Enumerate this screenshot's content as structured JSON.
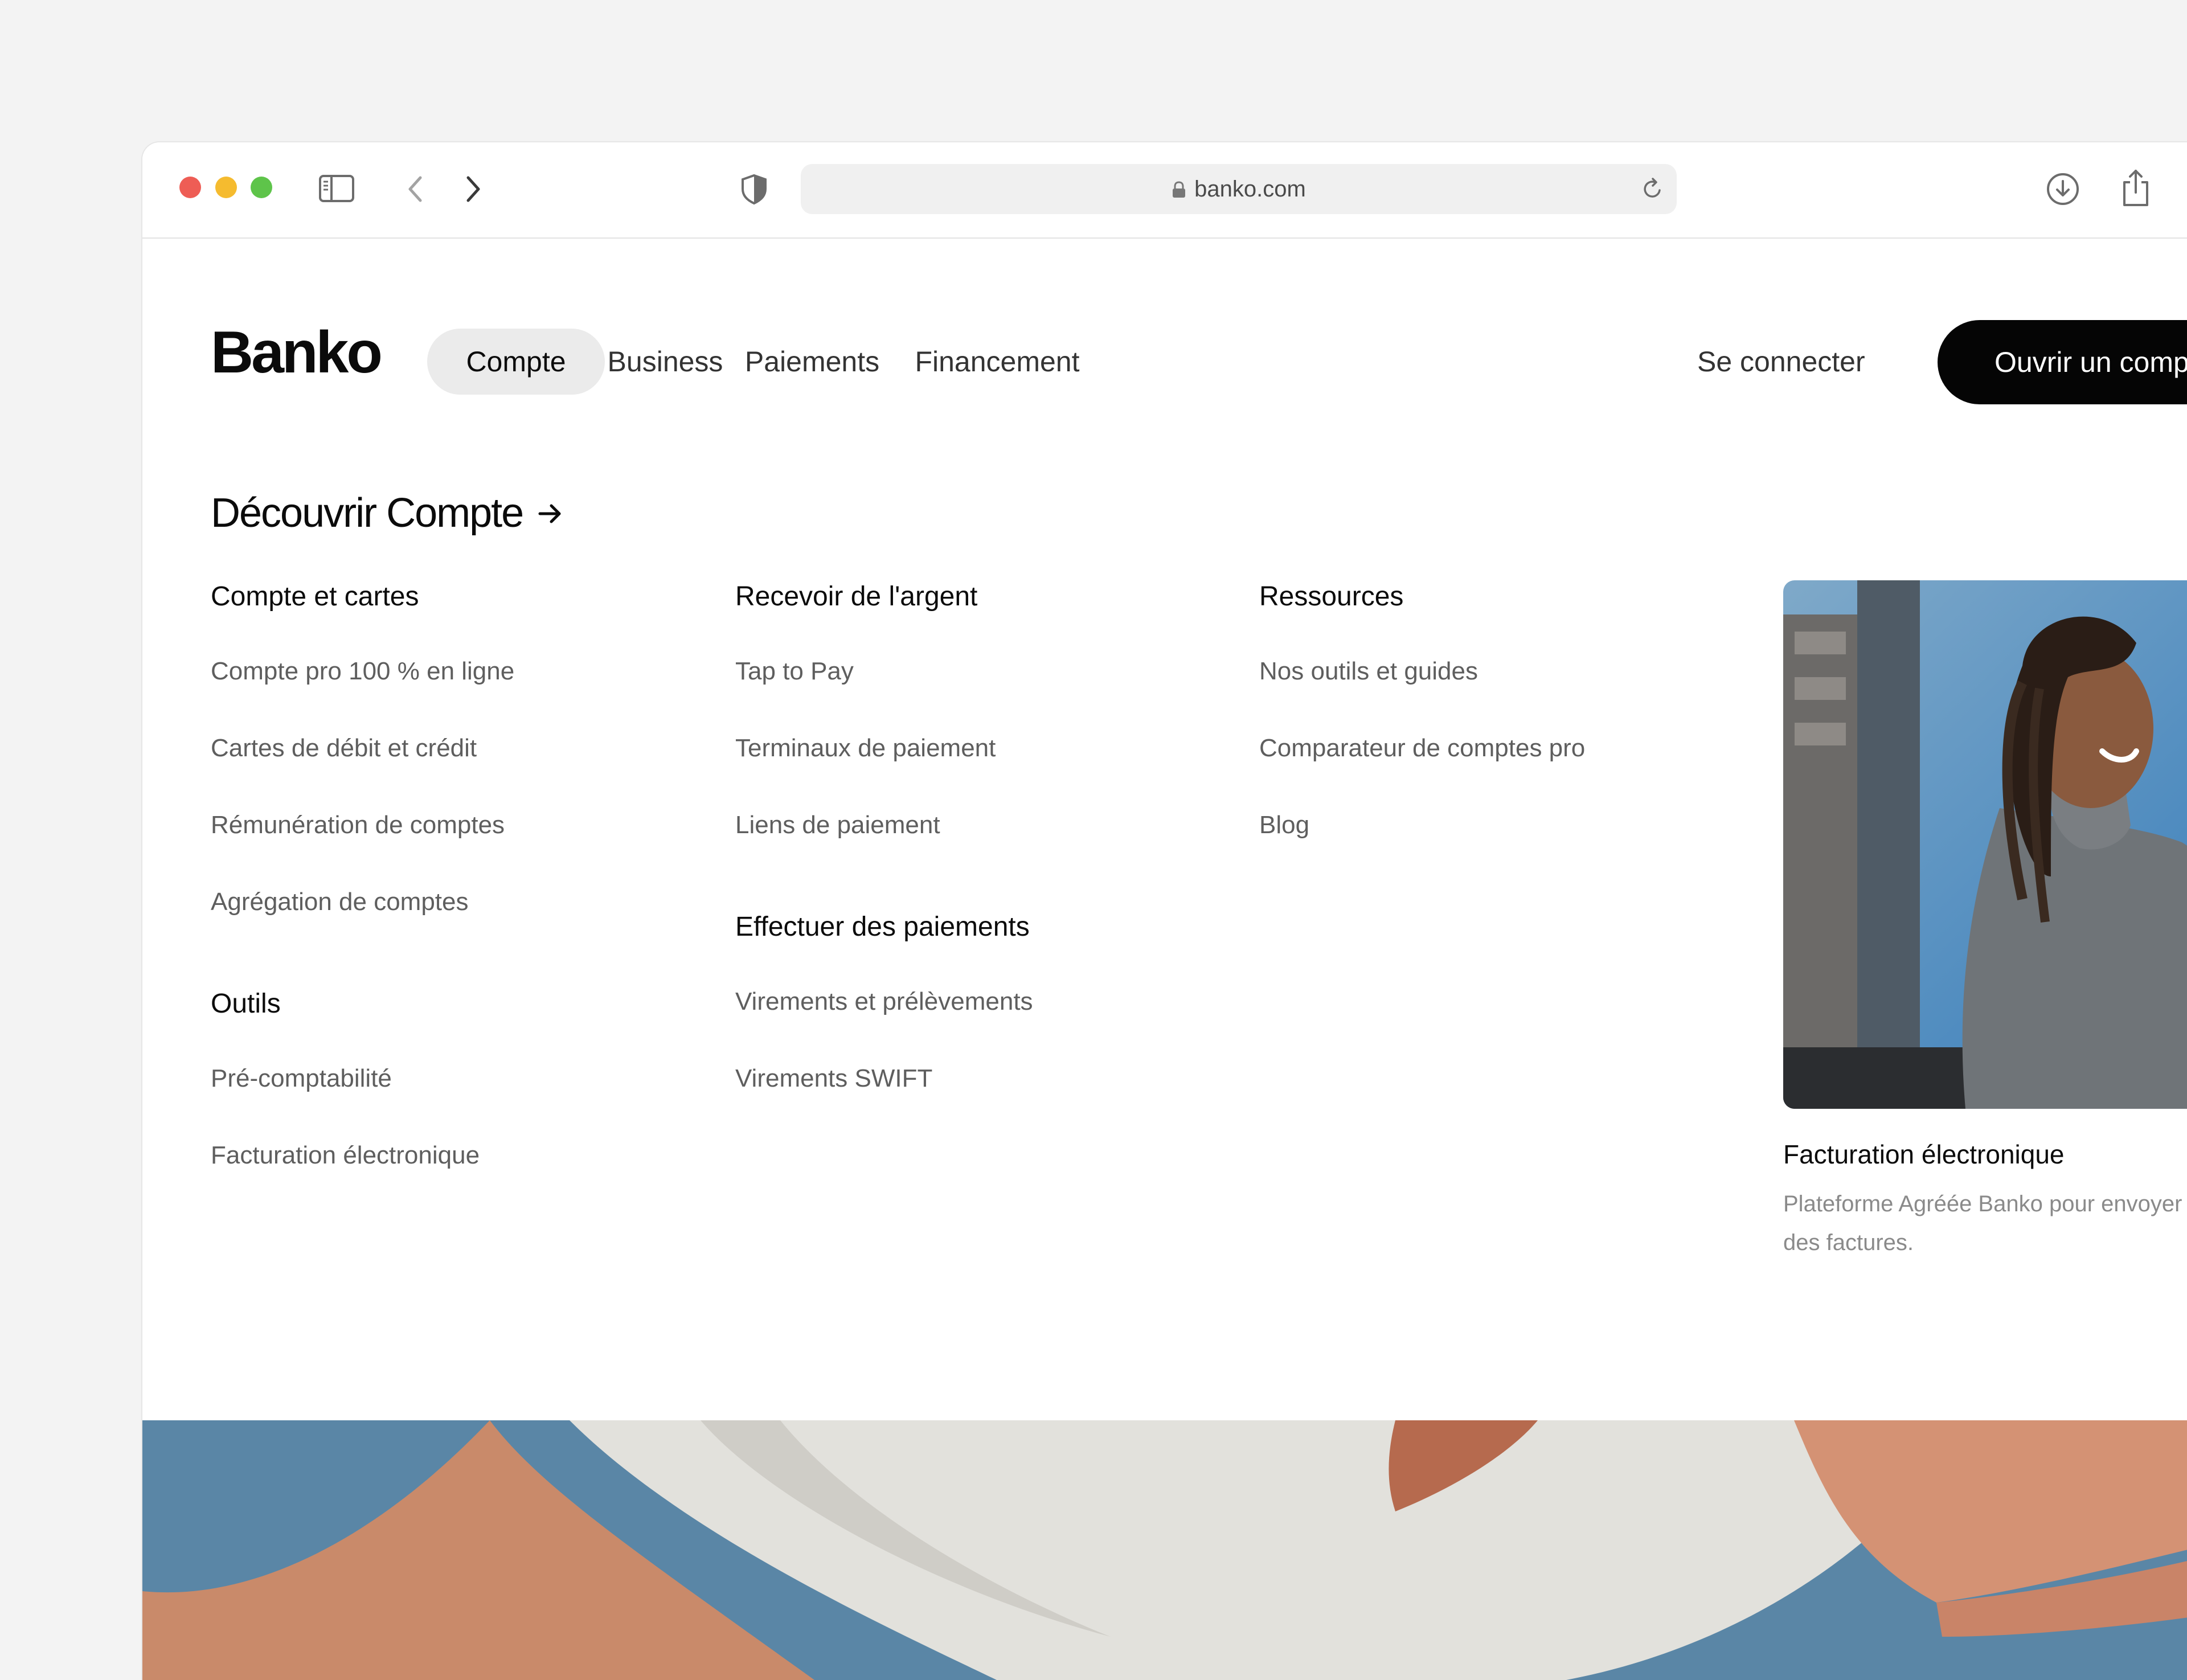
{
  "browser": {
    "url": "banko.com",
    "traffic_lights": {
      "close": "#ee5d55",
      "minimize": "#f5bb2f",
      "zoom": "#5ec44a"
    }
  },
  "header": {
    "logo": "Banko",
    "nav": [
      {
        "label": "Compte",
        "active": true
      },
      {
        "label": "Business",
        "active": false
      },
      {
        "label": "Paiements",
        "active": false
      },
      {
        "label": "Financement",
        "active": false
      }
    ],
    "login_label": "Se connecter",
    "cta_label": "Ouvrir un compte"
  },
  "menu": {
    "discover_label": "Découvrir Compte",
    "columns": [
      {
        "heading": "Compte et cartes",
        "links": [
          "Compte pro 100 % en ligne",
          "Cartes de débit et crédit",
          "Rémunération de comptes",
          "Agrégation de comptes"
        ]
      },
      {
        "heading": "Outils",
        "links": [
          "Pré-comptabilité",
          "Facturation électronique"
        ]
      },
      {
        "heading": "Recevoir de l'argent",
        "links": [
          "Tap to Pay",
          "Terminaux de paiement",
          "Liens de paiement"
        ]
      },
      {
        "heading": "Effectuer des paiements",
        "links": [
          "Virements et prélèvements",
          "Virements SWIFT"
        ]
      },
      {
        "heading": "Ressources",
        "links": [
          "Nos outils et guides",
          "Comparateur de comptes pro",
          "Blog"
        ]
      }
    ],
    "feature": {
      "title": "Facturation électronique",
      "description": "Plateforme Agréée Banko pour envoyer et recevoir des factures."
    }
  },
  "colors": {
    "accent": "#050505",
    "active_tab_bg": "#ebebeb",
    "link_text": "#5e5e5e"
  }
}
